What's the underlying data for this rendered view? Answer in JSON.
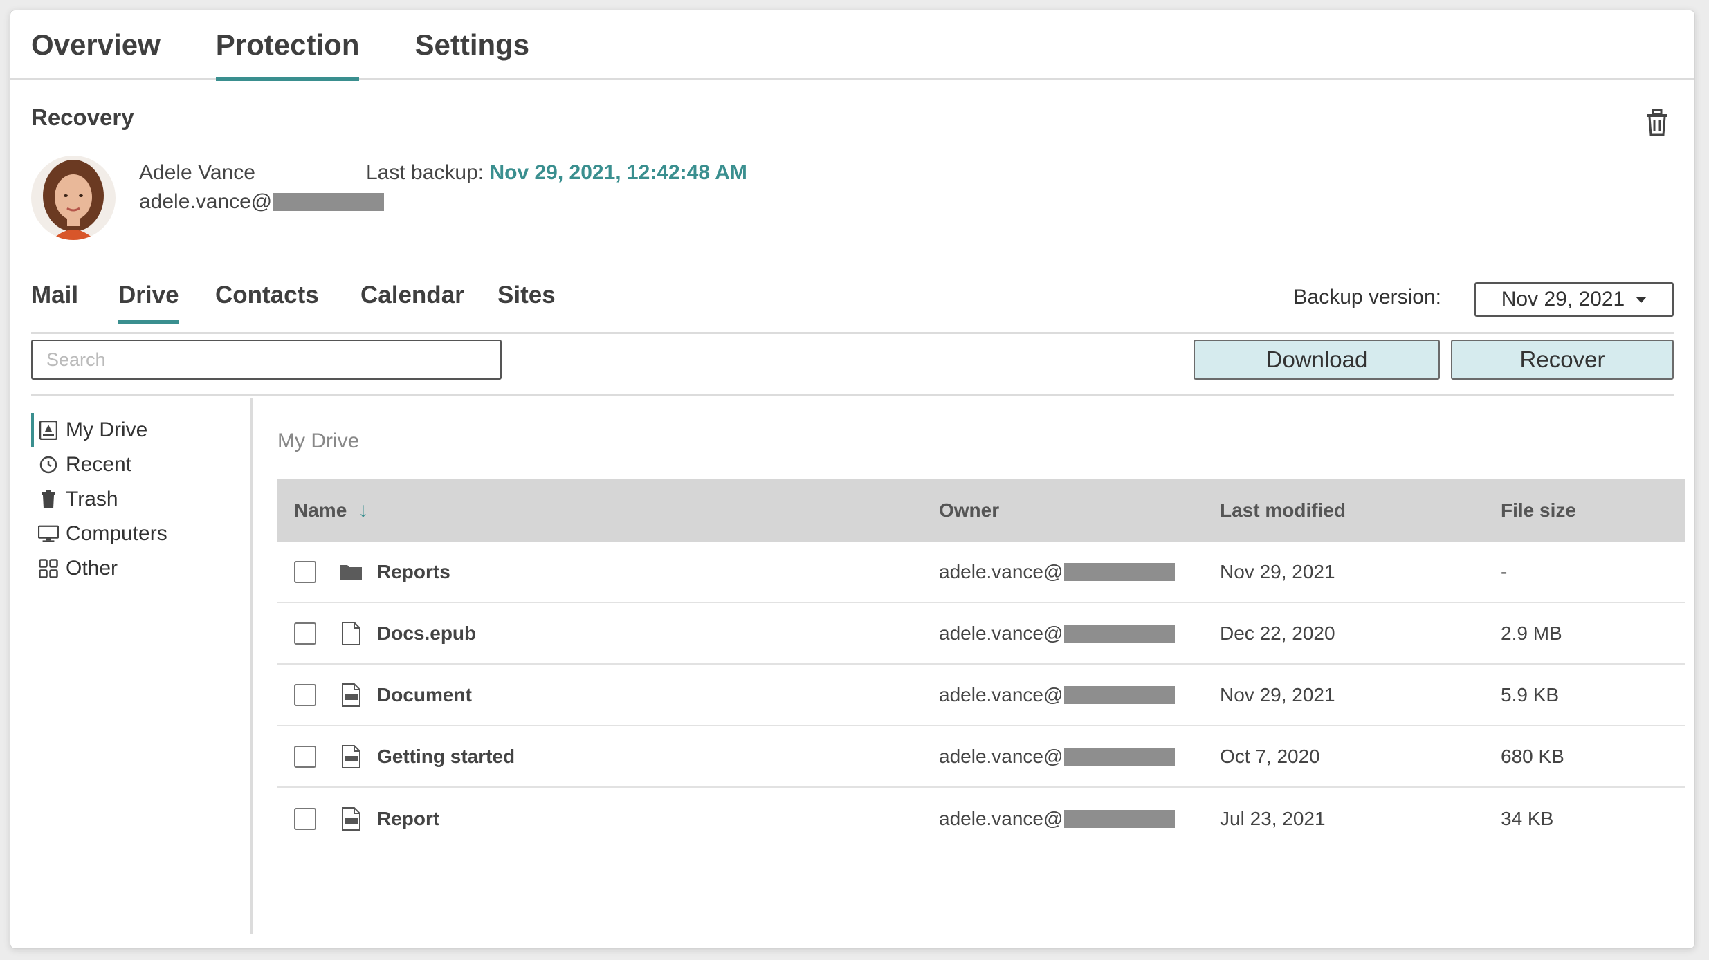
{
  "top_tabs": [
    "Overview",
    "Protection",
    "Settings"
  ],
  "active_top_tab": "Protection",
  "section_title": "Recovery",
  "user": {
    "name": "Adele Vance",
    "email_prefix": "adele.vance@",
    "last_backup_label": "Last backup:",
    "last_backup_value": "Nov 29, 2021, 12:42:48 AM"
  },
  "sub_tabs": [
    "Mail",
    "Drive",
    "Contacts",
    "Calendar",
    "Sites"
  ],
  "active_sub_tab": "Drive",
  "backup_version": {
    "label": "Backup version:",
    "value": "Nov 29, 2021"
  },
  "search": {
    "placeholder": "Search"
  },
  "buttons": {
    "download": "Download",
    "recover": "Recover"
  },
  "sidebar": [
    {
      "label": "My Drive",
      "icon": "my-drive-icon"
    },
    {
      "label": "Recent",
      "icon": "clock-icon"
    },
    {
      "label": "Trash",
      "icon": "trash-icon"
    },
    {
      "label": "Computers",
      "icon": "computer-icon"
    },
    {
      "label": "Other",
      "icon": "grid-icon"
    }
  ],
  "breadcrumb": "My Drive",
  "table": {
    "headers": {
      "name": "Name",
      "owner": "Owner",
      "modified": "Last modified",
      "size": "File size"
    },
    "rows": [
      {
        "name": "Reports",
        "type": "folder-icon",
        "owner": "adele.vance@",
        "modified": "Nov 29, 2021",
        "size": "-"
      },
      {
        "name": "Docs.epub",
        "type": "file-icon",
        "owner": "adele.vance@",
        "modified": "Dec 22, 2020",
        "size": "2.9 MB"
      },
      {
        "name": "Document",
        "type": "doc-icon",
        "owner": "adele.vance@",
        "modified": "Nov 29, 2021",
        "size": "5.9 KB"
      },
      {
        "name": "Getting started",
        "type": "pdf-icon",
        "owner": "adele.vance@",
        "modified": "Oct 7, 2020",
        "size": "680 KB"
      },
      {
        "name": "Report",
        "type": "ppt-icon",
        "owner": "adele.vance@",
        "modified": "Jul 23, 2021",
        "size": "34 KB"
      }
    ]
  },
  "colors": {
    "accent": "#3a8f8f",
    "button_bg": "#d6ebee"
  }
}
